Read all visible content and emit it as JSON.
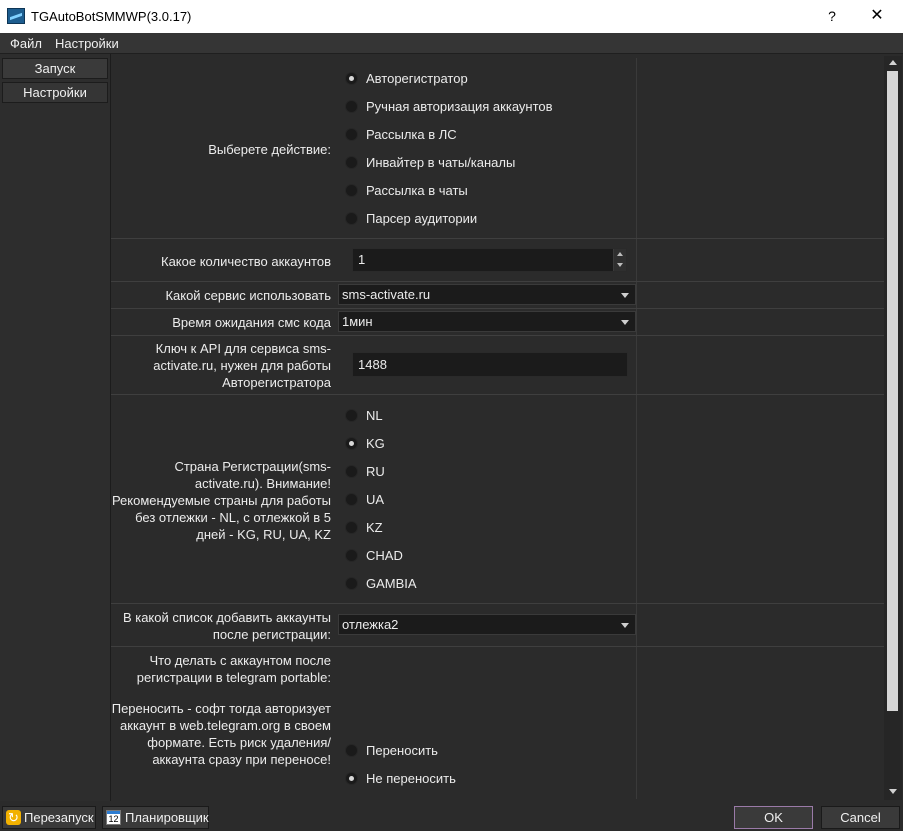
{
  "window": {
    "title": "TGAutoBotSMMWP(3.0.17)",
    "help": "?",
    "close": "✕"
  },
  "menu": {
    "file": "Файл",
    "settings": "Настройки"
  },
  "nav": {
    "launch": "Запуск",
    "settings": "Настройки"
  },
  "form": {
    "action_label": "Выберете действие:",
    "actions": [
      {
        "label": "Авторегистратор",
        "selected": true
      },
      {
        "label": "Ручная авторизация аккаунтов",
        "selected": false
      },
      {
        "label": "Рассылка в ЛС",
        "selected": false
      },
      {
        "label": "Инвайтер в чаты/каналы",
        "selected": false
      },
      {
        "label": "Рассылка в чаты",
        "selected": false
      },
      {
        "label": "Парсер аудитории",
        "selected": false
      }
    ],
    "accounts_label": "Какое количество аккаунтов",
    "accounts_value": "1",
    "service_label": "Какой сервис использовать",
    "service_value": "sms-activate.ru",
    "wait_label": "Время ожидания смс кода",
    "wait_value": "1мин",
    "api_label": "Ключ к API для сервиса sms-activate.ru, нужен для работы Авторегистратора",
    "api_value": "1488",
    "country_label": "Страна Регистрации(sms-activate.ru). Внимание! Рекомендуемые страны для работы без отлежки - NL, с отлежкой в 5 дней - KG, RU, UA, KZ",
    "countries": [
      {
        "label": "NL",
        "selected": false
      },
      {
        "label": "KG",
        "selected": true
      },
      {
        "label": "RU",
        "selected": false
      },
      {
        "label": "UA",
        "selected": false
      },
      {
        "label": "KZ",
        "selected": false
      },
      {
        "label": "CHAD",
        "selected": false
      },
      {
        "label": "GAMBIA",
        "selected": false
      }
    ],
    "list_label": "В какой список добавить аккаунты после регистрации:",
    "list_value": "отлежка2",
    "after_label_1": "Что делать с аккаунтом после регистрации в telegram portable:",
    "after_label_2": "Переносить - софт тогда авторизует аккаунт в web.telegram.org в своем формате. Есть риск удаления/аккаунта сразу при переносе!",
    "after_options": [
      {
        "label": "Переносить",
        "selected": false
      },
      {
        "label": "Не переносить",
        "selected": true
      }
    ]
  },
  "bottom": {
    "restart": "Перезапуск",
    "scheduler": "Планировщик",
    "scheduler_icon_text": "12",
    "ok": "OK",
    "cancel": "Cancel"
  },
  "icons": {
    "app": "app-logo-icon",
    "restart": "restart-icon",
    "scheduler": "calendar-icon"
  }
}
